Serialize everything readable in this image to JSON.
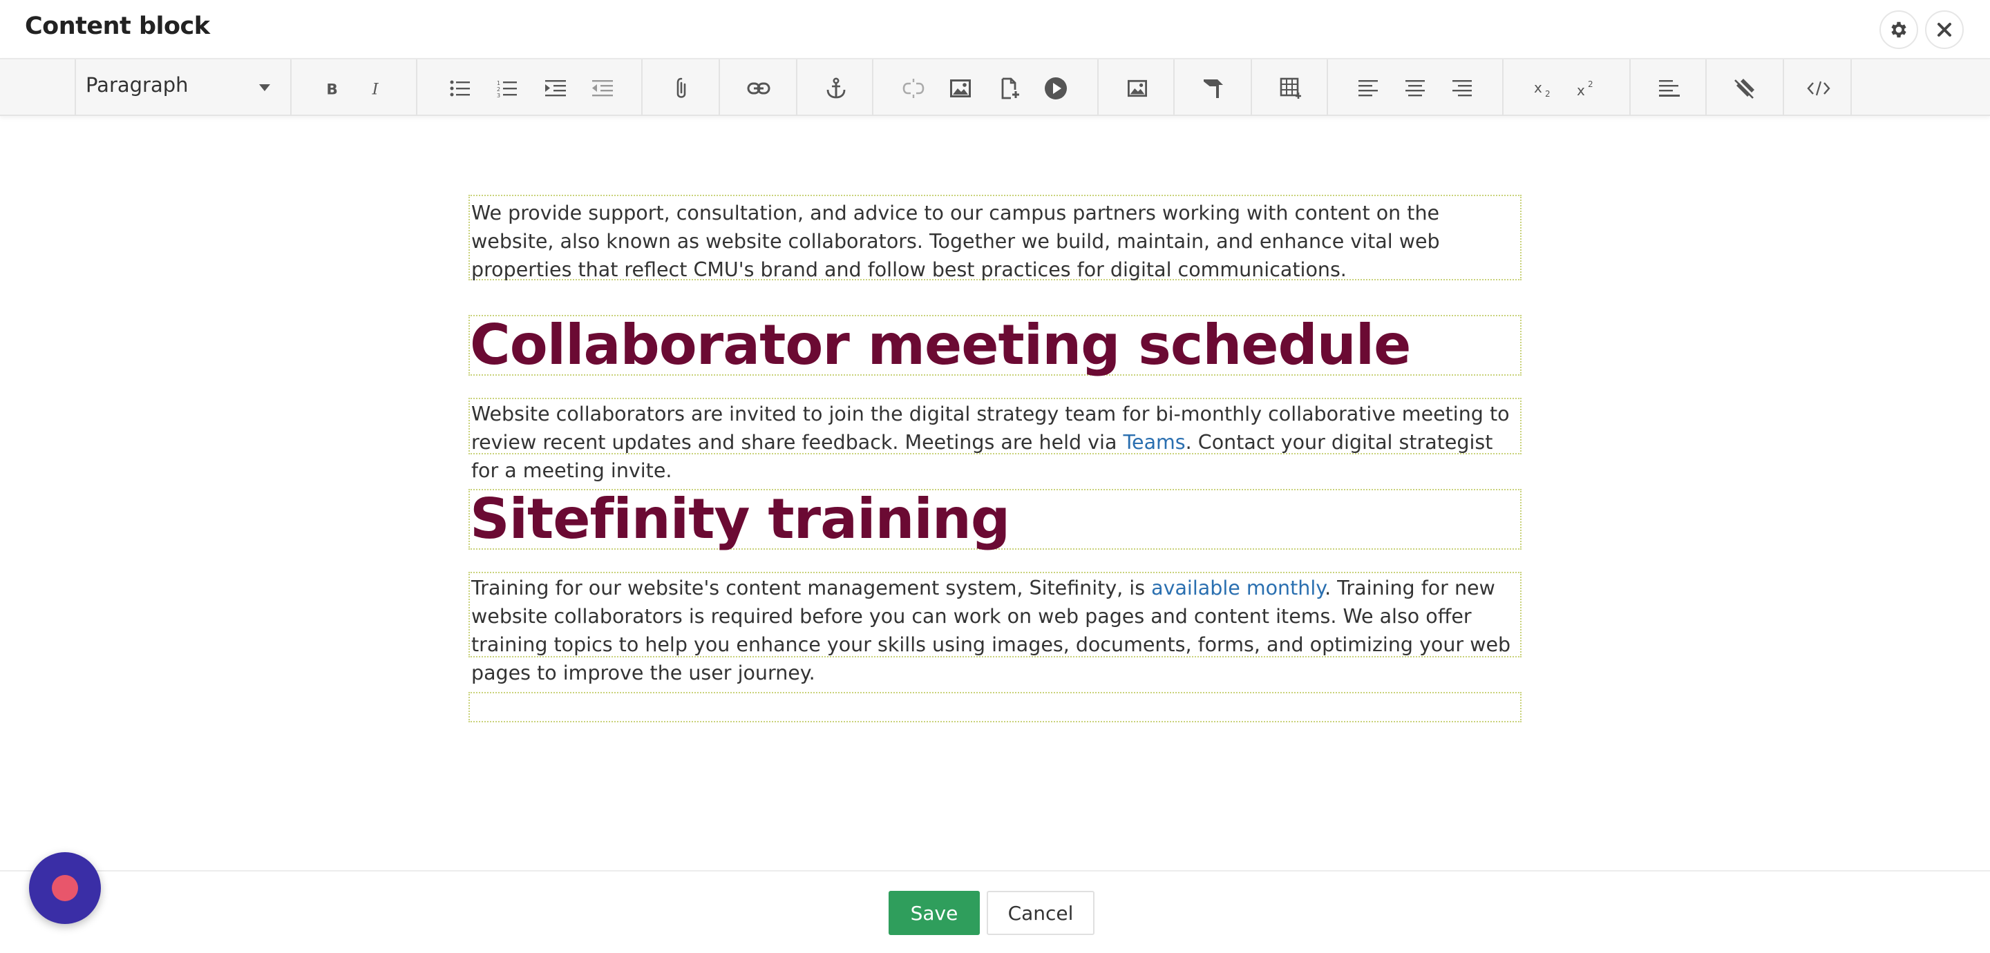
{
  "window": {
    "title": "Content block"
  },
  "toolbar": {
    "format_value": "Paragraph"
  },
  "content": {
    "p1": "We provide support, consultation, and advice to our campus partners working with content on the website, also known as website collaborators. Together we build, maintain, and enhance vital web properties that reflect CMU's brand and follow best practices for digital communications.",
    "h1": "Collaborator meeting schedule",
    "p2_before": "Website collaborators are invited to join the digital strategy team for bi-monthly collaborative meeting to review recent updates and share feedback. Meetings are held via ",
    "p2_link": "Teams",
    "p2_after": ". Contact your digital strategist for a meeting invite.",
    "h2": "Sitefinity training",
    "p3_before": "Training for our website's content management system, Sitefinity, is ",
    "p3_link": "available monthly",
    "p3_after": ". Training for new website collaborators is required before you can work on web pages and content items. We also offer training topics to help you enhance your skills using images, documents, forms, and optimizing your web pages to improve the user journey."
  },
  "footer": {
    "save_label": "Save",
    "cancel_label": "Cancel"
  },
  "colors": {
    "heading": "#6b0a33",
    "link": "#2a6fb0",
    "save": "#2f9e5c",
    "fab": "#3a2ea6",
    "fab_dot": "#e8566b"
  }
}
